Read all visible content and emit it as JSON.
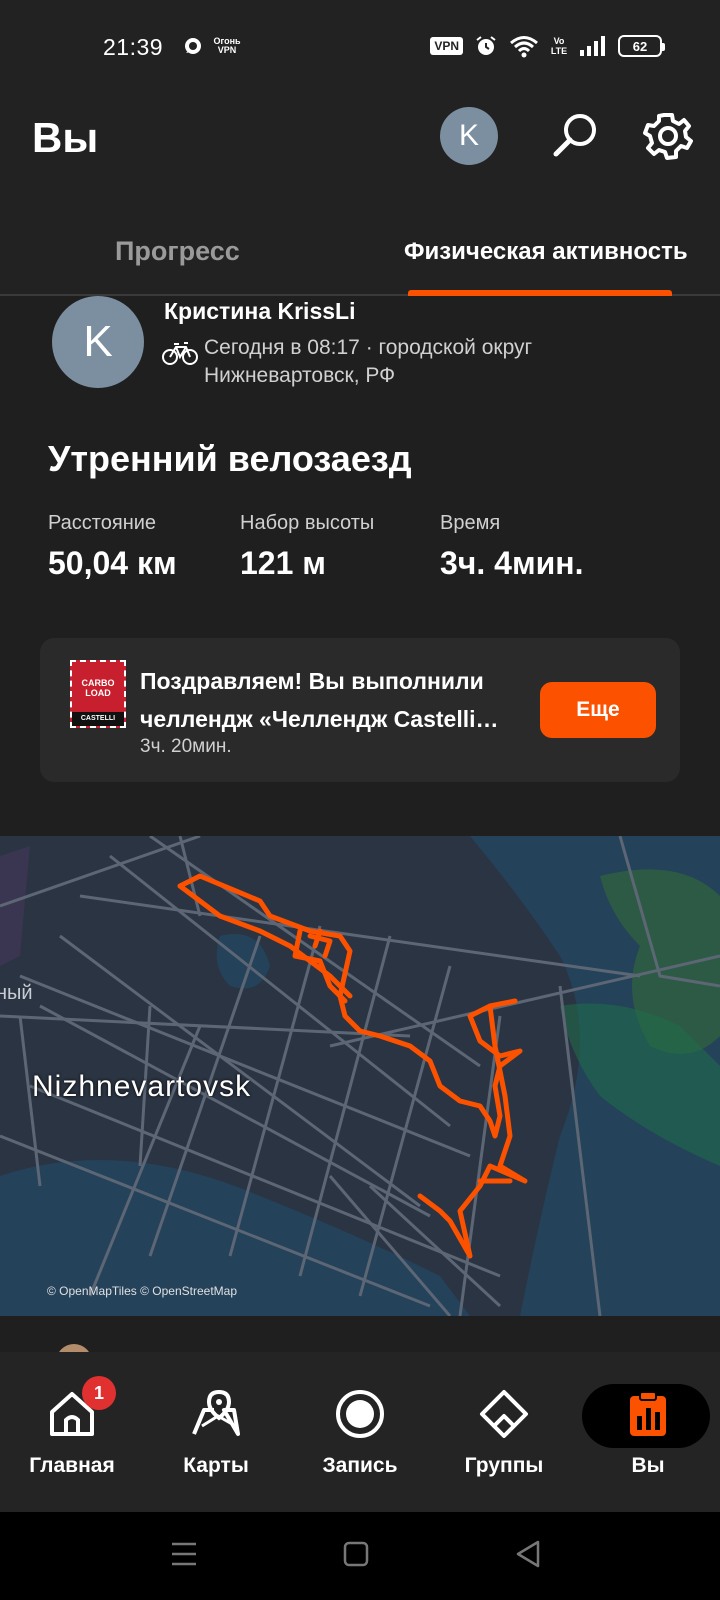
{
  "status_bar": {
    "time": "21:39",
    "vpn_small": "Огонь VPN",
    "vpn_badge": "VPN",
    "volte": "Vo LTE",
    "battery": "62"
  },
  "header": {
    "title": "Вы",
    "avatar_initial": "K",
    "search_icon": "search-icon",
    "settings_icon": "gear-icon"
  },
  "tabs": {
    "progress": "Прогресс",
    "activity": "Физическая активность",
    "active": "activity"
  },
  "activity": {
    "athlete_initial": "K",
    "athlete_name": "Кристина KrissLi",
    "meta_line1": "Сегодня в 08:17 · городской округ",
    "meta_line2": "Нижневартовск, РФ",
    "sport_icon": "bike-icon",
    "title": "Утренний велозаезд",
    "stats": [
      {
        "label": "Расстояние",
        "value": "50,04 км"
      },
      {
        "label": "Набор высоты",
        "value": "121 м"
      },
      {
        "label": "Время",
        "value": "3ч. 4мин."
      }
    ],
    "challenge": {
      "line1": "Поздравляем! Вы выполнили",
      "line2": "челлендж «Челлендж Castelli…",
      "duration": "3ч. 20мин.",
      "button": "Еще",
      "badge_mark": "CARBO LOAD",
      "badge_brand": "CASTELLI"
    }
  },
  "map": {
    "city": "Nizhnevartovsk",
    "place_partial": "ный",
    "attribution": "© OpenMapTiles © OpenStreetMap",
    "route_color": "#fc5200"
  },
  "bottom_nav": {
    "items": [
      {
        "label": "Главная",
        "icon": "home-icon",
        "badge": "1"
      },
      {
        "label": "Карты",
        "icon": "map-icon"
      },
      {
        "label": "Запись",
        "icon": "record-icon"
      },
      {
        "label": "Группы",
        "icon": "groups-icon"
      },
      {
        "label": "Вы",
        "icon": "you-icon",
        "active": true
      }
    ]
  },
  "colors": {
    "accent": "#fc5200",
    "background": "#1f1f1f",
    "header": "#222222",
    "avatar": "#7c8fa0"
  }
}
